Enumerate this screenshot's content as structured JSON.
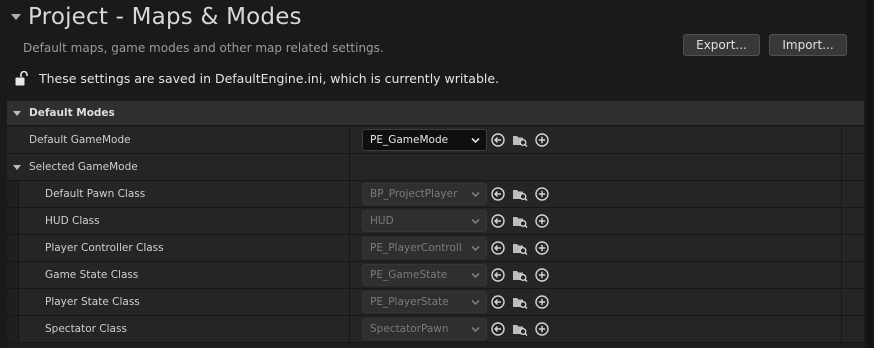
{
  "header": {
    "title": "Project - Maps & Modes",
    "subtitle": "Default maps, game modes and other map related settings.",
    "export_label": "Export...",
    "import_label": "Import...",
    "config_status": "These settings are saved in DefaultEngine.ini, which is currently writable."
  },
  "category": {
    "label": "Default Modes"
  },
  "default_gamemode": {
    "label": "Default GameMode",
    "value": "PE_GameMode"
  },
  "selected_gamemode": {
    "label": "Selected GameMode",
    "rows": [
      {
        "label": "Default Pawn Class",
        "value": "BP_ProjectPlayer"
      },
      {
        "label": "HUD Class",
        "value": "HUD"
      },
      {
        "label": "Player Controller Class",
        "value": "PE_PlayerControll"
      },
      {
        "label": "Game State Class",
        "value": "PE_GameState"
      },
      {
        "label": "Player State Class",
        "value": "PE_PlayerState"
      },
      {
        "label": "Spectator Class",
        "value": "SpectatorPawn"
      }
    ]
  },
  "icons": {
    "lock": "unlock-icon",
    "back": "use-selected-icon",
    "browse": "browse-folder-icon",
    "add": "add-icon"
  },
  "colors": {
    "background": "#1a1a1a",
    "row": "#252525",
    "category": "#2f2f2f",
    "text": "#cfcfcf"
  }
}
